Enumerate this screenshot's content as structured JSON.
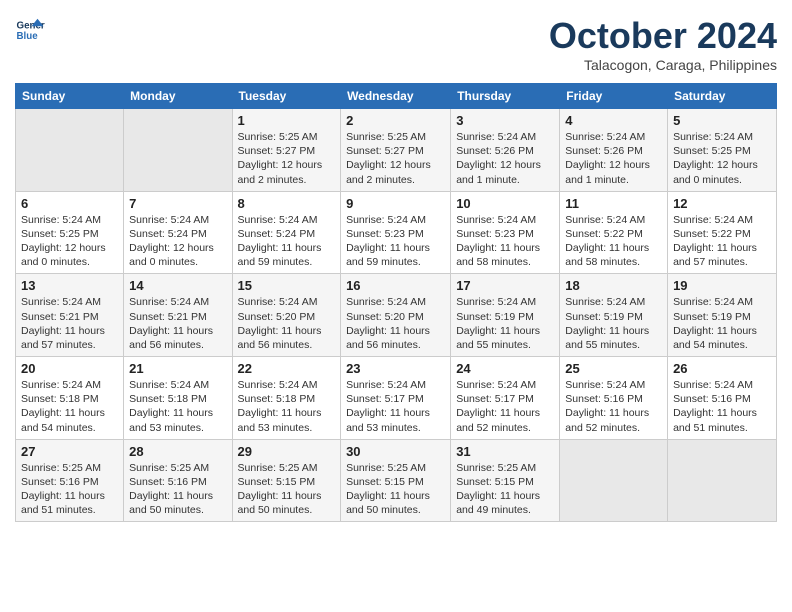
{
  "header": {
    "logo_line1": "General",
    "logo_line2": "Blue",
    "month_title": "October 2024",
    "subtitle": "Talacogon, Caraga, Philippines"
  },
  "weekdays": [
    "Sunday",
    "Monday",
    "Tuesday",
    "Wednesday",
    "Thursday",
    "Friday",
    "Saturday"
  ],
  "weeks": [
    [
      {
        "day": "",
        "info": ""
      },
      {
        "day": "",
        "info": ""
      },
      {
        "day": "1",
        "info": "Sunrise: 5:25 AM\nSunset: 5:27 PM\nDaylight: 12 hours and 2 minutes."
      },
      {
        "day": "2",
        "info": "Sunrise: 5:25 AM\nSunset: 5:27 PM\nDaylight: 12 hours and 2 minutes."
      },
      {
        "day": "3",
        "info": "Sunrise: 5:24 AM\nSunset: 5:26 PM\nDaylight: 12 hours and 1 minute."
      },
      {
        "day": "4",
        "info": "Sunrise: 5:24 AM\nSunset: 5:26 PM\nDaylight: 12 hours and 1 minute."
      },
      {
        "day": "5",
        "info": "Sunrise: 5:24 AM\nSunset: 5:25 PM\nDaylight: 12 hours and 0 minutes."
      }
    ],
    [
      {
        "day": "6",
        "info": "Sunrise: 5:24 AM\nSunset: 5:25 PM\nDaylight: 12 hours and 0 minutes."
      },
      {
        "day": "7",
        "info": "Sunrise: 5:24 AM\nSunset: 5:24 PM\nDaylight: 12 hours and 0 minutes."
      },
      {
        "day": "8",
        "info": "Sunrise: 5:24 AM\nSunset: 5:24 PM\nDaylight: 11 hours and 59 minutes."
      },
      {
        "day": "9",
        "info": "Sunrise: 5:24 AM\nSunset: 5:23 PM\nDaylight: 11 hours and 59 minutes."
      },
      {
        "day": "10",
        "info": "Sunrise: 5:24 AM\nSunset: 5:23 PM\nDaylight: 11 hours and 58 minutes."
      },
      {
        "day": "11",
        "info": "Sunrise: 5:24 AM\nSunset: 5:22 PM\nDaylight: 11 hours and 58 minutes."
      },
      {
        "day": "12",
        "info": "Sunrise: 5:24 AM\nSunset: 5:22 PM\nDaylight: 11 hours and 57 minutes."
      }
    ],
    [
      {
        "day": "13",
        "info": "Sunrise: 5:24 AM\nSunset: 5:21 PM\nDaylight: 11 hours and 57 minutes."
      },
      {
        "day": "14",
        "info": "Sunrise: 5:24 AM\nSunset: 5:21 PM\nDaylight: 11 hours and 56 minutes."
      },
      {
        "day": "15",
        "info": "Sunrise: 5:24 AM\nSunset: 5:20 PM\nDaylight: 11 hours and 56 minutes."
      },
      {
        "day": "16",
        "info": "Sunrise: 5:24 AM\nSunset: 5:20 PM\nDaylight: 11 hours and 56 minutes."
      },
      {
        "day": "17",
        "info": "Sunrise: 5:24 AM\nSunset: 5:19 PM\nDaylight: 11 hours and 55 minutes."
      },
      {
        "day": "18",
        "info": "Sunrise: 5:24 AM\nSunset: 5:19 PM\nDaylight: 11 hours and 55 minutes."
      },
      {
        "day": "19",
        "info": "Sunrise: 5:24 AM\nSunset: 5:19 PM\nDaylight: 11 hours and 54 minutes."
      }
    ],
    [
      {
        "day": "20",
        "info": "Sunrise: 5:24 AM\nSunset: 5:18 PM\nDaylight: 11 hours and 54 minutes."
      },
      {
        "day": "21",
        "info": "Sunrise: 5:24 AM\nSunset: 5:18 PM\nDaylight: 11 hours and 53 minutes."
      },
      {
        "day": "22",
        "info": "Sunrise: 5:24 AM\nSunset: 5:18 PM\nDaylight: 11 hours and 53 minutes."
      },
      {
        "day": "23",
        "info": "Sunrise: 5:24 AM\nSunset: 5:17 PM\nDaylight: 11 hours and 53 minutes."
      },
      {
        "day": "24",
        "info": "Sunrise: 5:24 AM\nSunset: 5:17 PM\nDaylight: 11 hours and 52 minutes."
      },
      {
        "day": "25",
        "info": "Sunrise: 5:24 AM\nSunset: 5:16 PM\nDaylight: 11 hours and 52 minutes."
      },
      {
        "day": "26",
        "info": "Sunrise: 5:24 AM\nSunset: 5:16 PM\nDaylight: 11 hours and 51 minutes."
      }
    ],
    [
      {
        "day": "27",
        "info": "Sunrise: 5:25 AM\nSunset: 5:16 PM\nDaylight: 11 hours and 51 minutes."
      },
      {
        "day": "28",
        "info": "Sunrise: 5:25 AM\nSunset: 5:16 PM\nDaylight: 11 hours and 50 minutes."
      },
      {
        "day": "29",
        "info": "Sunrise: 5:25 AM\nSunset: 5:15 PM\nDaylight: 11 hours and 50 minutes."
      },
      {
        "day": "30",
        "info": "Sunrise: 5:25 AM\nSunset: 5:15 PM\nDaylight: 11 hours and 50 minutes."
      },
      {
        "day": "31",
        "info": "Sunrise: 5:25 AM\nSunset: 5:15 PM\nDaylight: 11 hours and 49 minutes."
      },
      {
        "day": "",
        "info": ""
      },
      {
        "day": "",
        "info": ""
      }
    ]
  ]
}
